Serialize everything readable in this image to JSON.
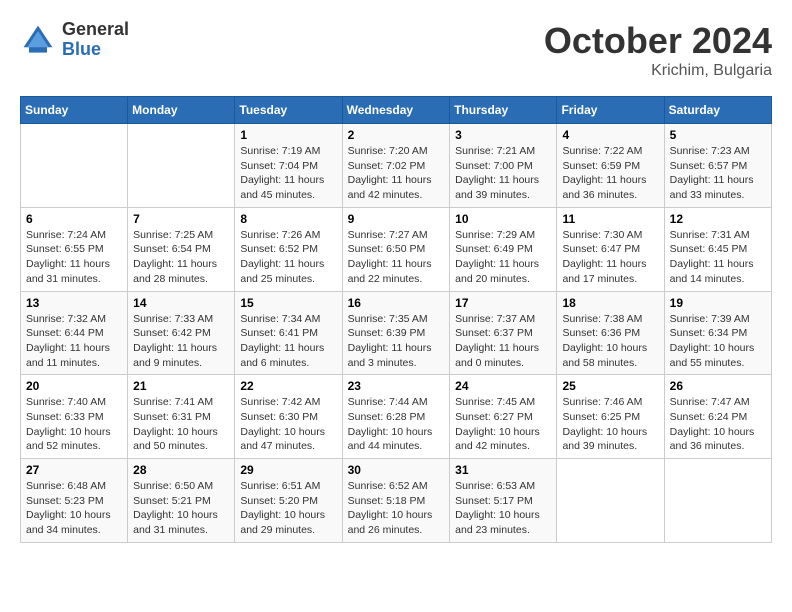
{
  "header": {
    "logo_general": "General",
    "logo_blue": "Blue",
    "month_title": "October 2024",
    "location": "Krichim, Bulgaria"
  },
  "days_of_week": [
    "Sunday",
    "Monday",
    "Tuesday",
    "Wednesday",
    "Thursday",
    "Friday",
    "Saturday"
  ],
  "weeks": [
    [
      {
        "day": "",
        "sunrise": "",
        "sunset": "",
        "daylight": ""
      },
      {
        "day": "",
        "sunrise": "",
        "sunset": "",
        "daylight": ""
      },
      {
        "day": "1",
        "sunrise": "Sunrise: 7:19 AM",
        "sunset": "Sunset: 7:04 PM",
        "daylight": "Daylight: 11 hours and 45 minutes."
      },
      {
        "day": "2",
        "sunrise": "Sunrise: 7:20 AM",
        "sunset": "Sunset: 7:02 PM",
        "daylight": "Daylight: 11 hours and 42 minutes."
      },
      {
        "day": "3",
        "sunrise": "Sunrise: 7:21 AM",
        "sunset": "Sunset: 7:00 PM",
        "daylight": "Daylight: 11 hours and 39 minutes."
      },
      {
        "day": "4",
        "sunrise": "Sunrise: 7:22 AM",
        "sunset": "Sunset: 6:59 PM",
        "daylight": "Daylight: 11 hours and 36 minutes."
      },
      {
        "day": "5",
        "sunrise": "Sunrise: 7:23 AM",
        "sunset": "Sunset: 6:57 PM",
        "daylight": "Daylight: 11 hours and 33 minutes."
      }
    ],
    [
      {
        "day": "6",
        "sunrise": "Sunrise: 7:24 AM",
        "sunset": "Sunset: 6:55 PM",
        "daylight": "Daylight: 11 hours and 31 minutes."
      },
      {
        "day": "7",
        "sunrise": "Sunrise: 7:25 AM",
        "sunset": "Sunset: 6:54 PM",
        "daylight": "Daylight: 11 hours and 28 minutes."
      },
      {
        "day": "8",
        "sunrise": "Sunrise: 7:26 AM",
        "sunset": "Sunset: 6:52 PM",
        "daylight": "Daylight: 11 hours and 25 minutes."
      },
      {
        "day": "9",
        "sunrise": "Sunrise: 7:27 AM",
        "sunset": "Sunset: 6:50 PM",
        "daylight": "Daylight: 11 hours and 22 minutes."
      },
      {
        "day": "10",
        "sunrise": "Sunrise: 7:29 AM",
        "sunset": "Sunset: 6:49 PM",
        "daylight": "Daylight: 11 hours and 20 minutes."
      },
      {
        "day": "11",
        "sunrise": "Sunrise: 7:30 AM",
        "sunset": "Sunset: 6:47 PM",
        "daylight": "Daylight: 11 hours and 17 minutes."
      },
      {
        "day": "12",
        "sunrise": "Sunrise: 7:31 AM",
        "sunset": "Sunset: 6:45 PM",
        "daylight": "Daylight: 11 hours and 14 minutes."
      }
    ],
    [
      {
        "day": "13",
        "sunrise": "Sunrise: 7:32 AM",
        "sunset": "Sunset: 6:44 PM",
        "daylight": "Daylight: 11 hours and 11 minutes."
      },
      {
        "day": "14",
        "sunrise": "Sunrise: 7:33 AM",
        "sunset": "Sunset: 6:42 PM",
        "daylight": "Daylight: 11 hours and 9 minutes."
      },
      {
        "day": "15",
        "sunrise": "Sunrise: 7:34 AM",
        "sunset": "Sunset: 6:41 PM",
        "daylight": "Daylight: 11 hours and 6 minutes."
      },
      {
        "day": "16",
        "sunrise": "Sunrise: 7:35 AM",
        "sunset": "Sunset: 6:39 PM",
        "daylight": "Daylight: 11 hours and 3 minutes."
      },
      {
        "day": "17",
        "sunrise": "Sunrise: 7:37 AM",
        "sunset": "Sunset: 6:37 PM",
        "daylight": "Daylight: 11 hours and 0 minutes."
      },
      {
        "day": "18",
        "sunrise": "Sunrise: 7:38 AM",
        "sunset": "Sunset: 6:36 PM",
        "daylight": "Daylight: 10 hours and 58 minutes."
      },
      {
        "day": "19",
        "sunrise": "Sunrise: 7:39 AM",
        "sunset": "Sunset: 6:34 PM",
        "daylight": "Daylight: 10 hours and 55 minutes."
      }
    ],
    [
      {
        "day": "20",
        "sunrise": "Sunrise: 7:40 AM",
        "sunset": "Sunset: 6:33 PM",
        "daylight": "Daylight: 10 hours and 52 minutes."
      },
      {
        "day": "21",
        "sunrise": "Sunrise: 7:41 AM",
        "sunset": "Sunset: 6:31 PM",
        "daylight": "Daylight: 10 hours and 50 minutes."
      },
      {
        "day": "22",
        "sunrise": "Sunrise: 7:42 AM",
        "sunset": "Sunset: 6:30 PM",
        "daylight": "Daylight: 10 hours and 47 minutes."
      },
      {
        "day": "23",
        "sunrise": "Sunrise: 7:44 AM",
        "sunset": "Sunset: 6:28 PM",
        "daylight": "Daylight: 10 hours and 44 minutes."
      },
      {
        "day": "24",
        "sunrise": "Sunrise: 7:45 AM",
        "sunset": "Sunset: 6:27 PM",
        "daylight": "Daylight: 10 hours and 42 minutes."
      },
      {
        "day": "25",
        "sunrise": "Sunrise: 7:46 AM",
        "sunset": "Sunset: 6:25 PM",
        "daylight": "Daylight: 10 hours and 39 minutes."
      },
      {
        "day": "26",
        "sunrise": "Sunrise: 7:47 AM",
        "sunset": "Sunset: 6:24 PM",
        "daylight": "Daylight: 10 hours and 36 minutes."
      }
    ],
    [
      {
        "day": "27",
        "sunrise": "Sunrise: 6:48 AM",
        "sunset": "Sunset: 5:23 PM",
        "daylight": "Daylight: 10 hours and 34 minutes."
      },
      {
        "day": "28",
        "sunrise": "Sunrise: 6:50 AM",
        "sunset": "Sunset: 5:21 PM",
        "daylight": "Daylight: 10 hours and 31 minutes."
      },
      {
        "day": "29",
        "sunrise": "Sunrise: 6:51 AM",
        "sunset": "Sunset: 5:20 PM",
        "daylight": "Daylight: 10 hours and 29 minutes."
      },
      {
        "day": "30",
        "sunrise": "Sunrise: 6:52 AM",
        "sunset": "Sunset: 5:18 PM",
        "daylight": "Daylight: 10 hours and 26 minutes."
      },
      {
        "day": "31",
        "sunrise": "Sunrise: 6:53 AM",
        "sunset": "Sunset: 5:17 PM",
        "daylight": "Daylight: 10 hours and 23 minutes."
      },
      {
        "day": "",
        "sunrise": "",
        "sunset": "",
        "daylight": ""
      },
      {
        "day": "",
        "sunrise": "",
        "sunset": "",
        "daylight": ""
      }
    ]
  ]
}
